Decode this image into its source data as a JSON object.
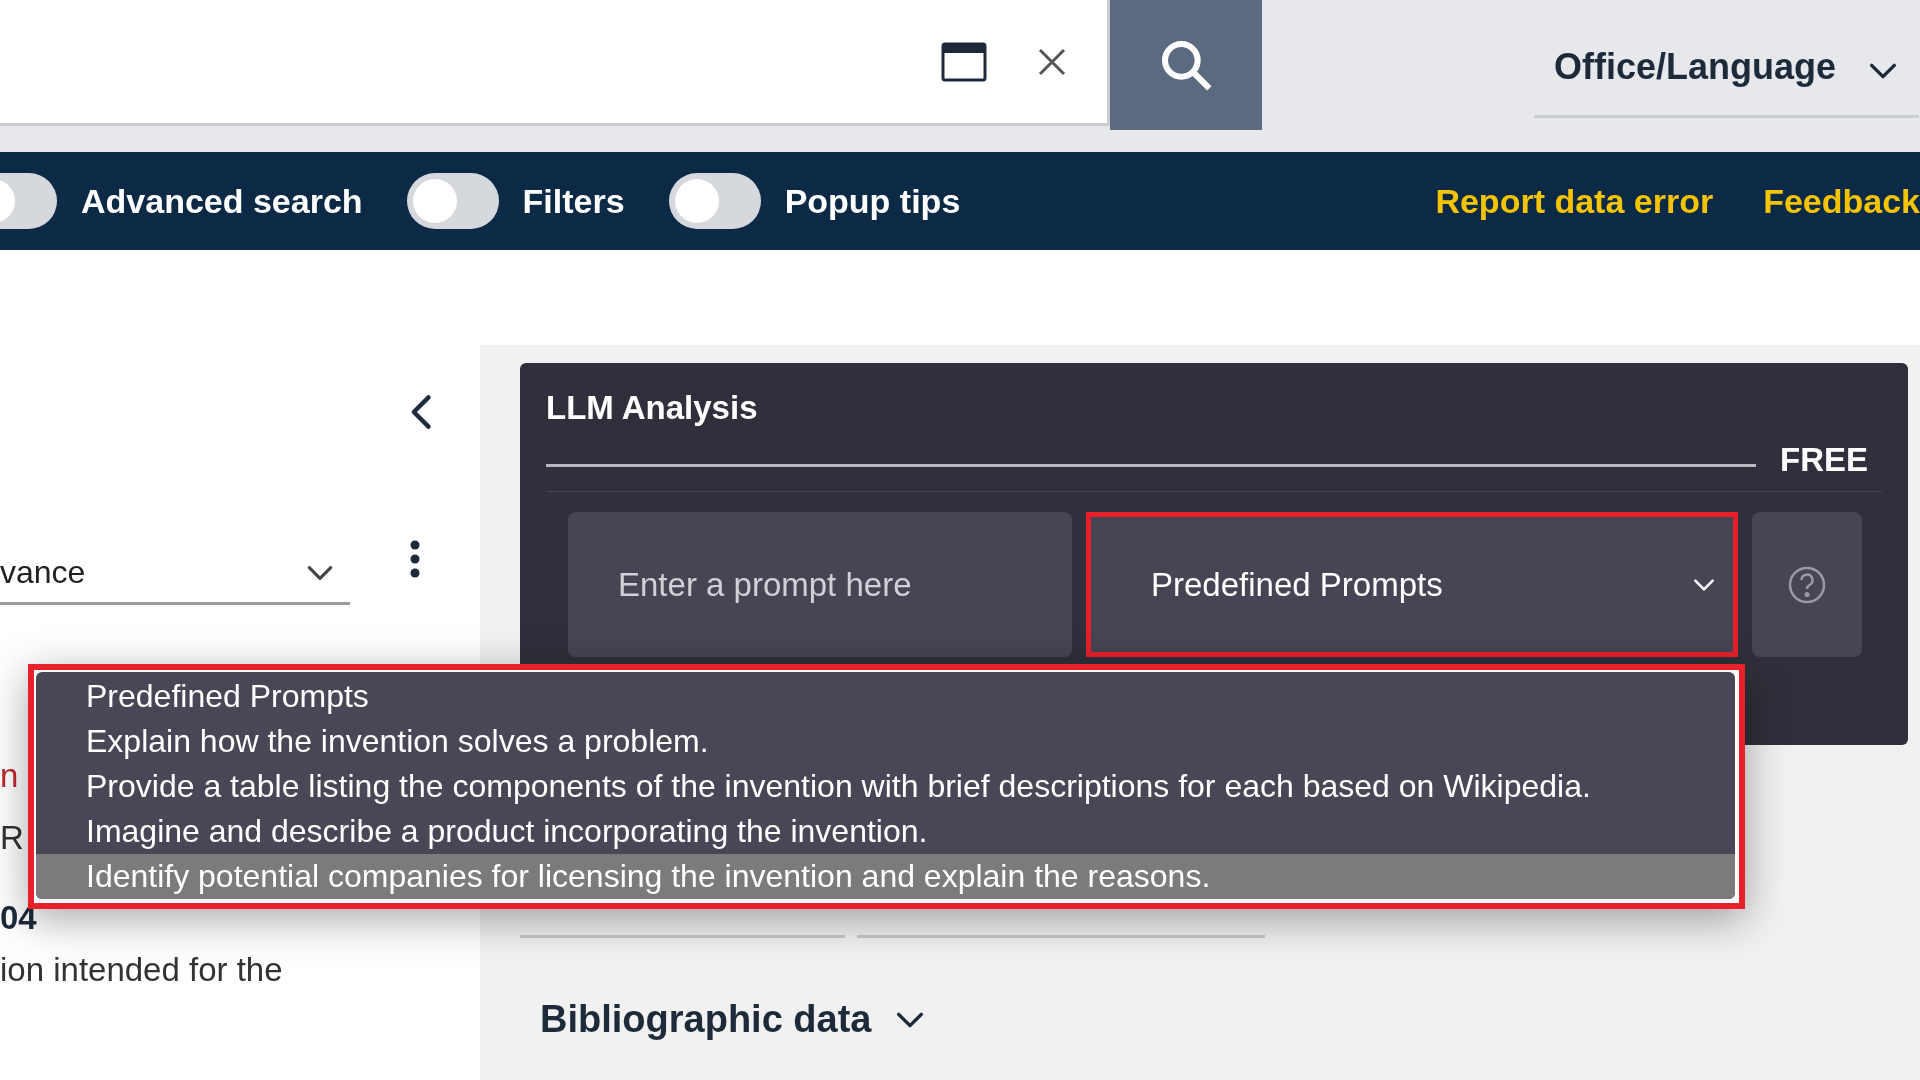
{
  "header": {
    "office_language": "Office/Language"
  },
  "toolbar": {
    "toggles": [
      {
        "label": "Advanced search",
        "on": false
      },
      {
        "label": "Filters",
        "on": false
      },
      {
        "label": "Popup tips",
        "on": false
      }
    ],
    "links": [
      "Report data error",
      "Feedback"
    ]
  },
  "left_panel": {
    "sort_value": "vance",
    "lines": [
      {
        "text": "n",
        "kind": "red"
      },
      {
        "text": "R",
        "kind": "plain"
      },
      {
        "text": "04",
        "kind": "bold"
      },
      {
        "text": "ion intended for the",
        "kind": "plain"
      }
    ]
  },
  "llm_panel": {
    "title": "LLM Analysis",
    "badge": "FREE",
    "prompt": {
      "placeholder": "Enter a prompt here"
    },
    "select": {
      "value": "Predefined Prompts",
      "highlighted": true
    },
    "dropdown": {
      "highlighted": true,
      "options": [
        {
          "label": "Predefined Prompts",
          "selected": false
        },
        {
          "label": "Explain how the invention solves a problem.",
          "selected": false
        },
        {
          "label": "Provide a table listing the components of the invention with brief descriptions for each based on Wikipedia.",
          "selected": false
        },
        {
          "label": "Imagine and describe a product incorporating the invention.",
          "selected": false
        },
        {
          "label": "Identify potential companies for licensing the invention and explain the reasons.",
          "selected": true
        }
      ]
    }
  },
  "section": {
    "title": "Bibliographic data"
  }
}
